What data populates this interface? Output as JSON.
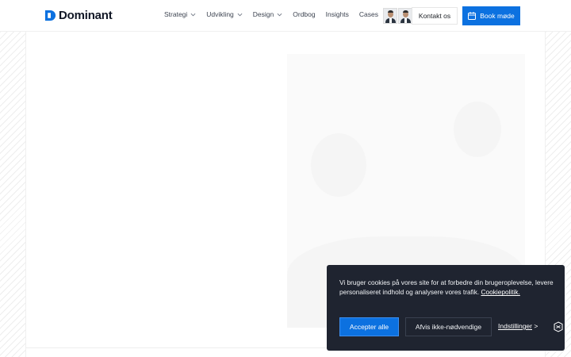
{
  "brand": {
    "name": "Dominant",
    "color": "#0c71e0"
  },
  "nav": {
    "items": [
      {
        "label": "Strategi",
        "dropdown": true
      },
      {
        "label": "Udvikling",
        "dropdown": true
      },
      {
        "label": "Design",
        "dropdown": true
      },
      {
        "label": "Ordbog",
        "dropdown": false
      },
      {
        "label": "Insights",
        "dropdown": false
      },
      {
        "label": "Cases",
        "dropdown": false
      }
    ]
  },
  "header": {
    "contact_label": "Kontakt os",
    "book_label": "Book møde",
    "book_icon": "calendar-icon"
  },
  "cookie_banner": {
    "text": "Vi bruger cookies på vores site for at forbedre din brugeroplevelse, levere personaliseret indhold og analysere vores trafik.",
    "policy_link": "Cookiepolitik.",
    "accept_label": "Accepter alle",
    "reject_label": "Afvis ikke-nødvendige",
    "settings_label": "Indstillinger",
    "settings_arrow": ">",
    "background": "#1f2430",
    "accent": "#0c71e0"
  }
}
